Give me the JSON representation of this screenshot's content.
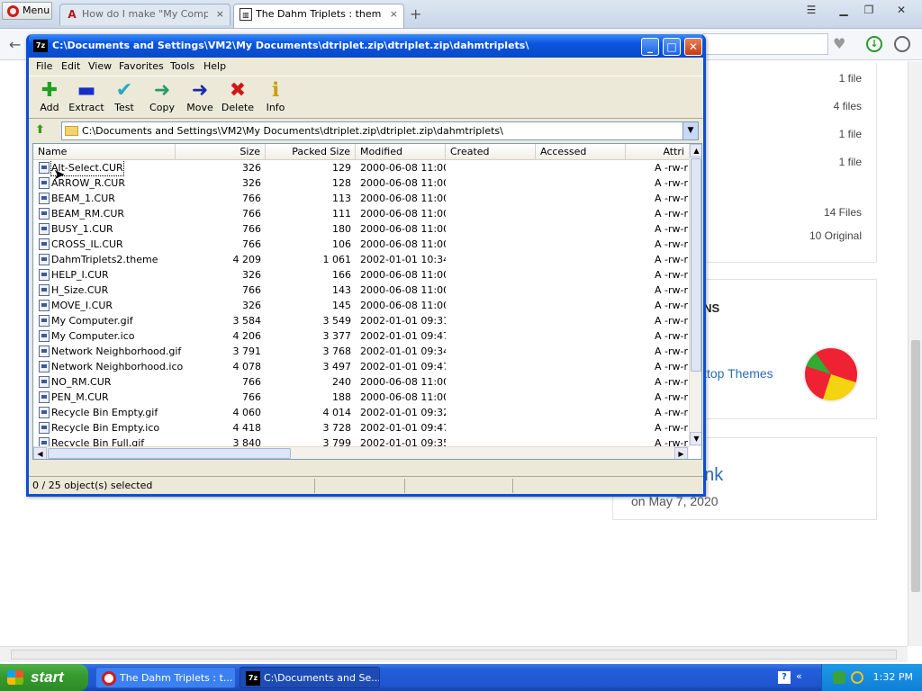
{
  "browser": {
    "menu_label": "Menu",
    "tabs": [
      {
        "title": "How do I make \"My Compute",
        "icon": "A",
        "active": false
      },
      {
        "title": "The Dahm Triplets : themewo",
        "icon": "▥",
        "active": true
      }
    ],
    "new_tab": "+",
    "close_glyph": "×"
  },
  "webpage": {
    "file_counts": [
      "1 file",
      "4 files",
      "1 file",
      "1 file"
    ],
    "total_files": "14 Files",
    "original": "10 Original",
    "section_heading": "ONS",
    "related_link": "sktop Themes",
    "post_title": "unk",
    "post_date": "on May 7, 2020"
  },
  "window": {
    "title": "C:\\Documents and Settings\\VM2\\My Documents\\dtriplet.zip\\dtriplet.zip\\dahmtriplets\\",
    "icon_label": "7z",
    "menu": [
      "File",
      "Edit",
      "View",
      "Favorites",
      "Tools",
      "Help"
    ],
    "toolbar": [
      {
        "label": "Add",
        "icon": "✚",
        "color": "#1ea11e"
      },
      {
        "label": "Extract",
        "icon": "▬",
        "color": "#1530c8"
      },
      {
        "label": "Test",
        "icon": "✔",
        "color": "#2aa7c7"
      },
      {
        "label": "Copy",
        "icon": "➜",
        "color": "#2a9a6a"
      },
      {
        "label": "Move",
        "icon": "➜",
        "color": "#1a2ab0"
      },
      {
        "label": "Delete",
        "icon": "✖",
        "color": "#d01818"
      },
      {
        "label": "Info",
        "icon": "ℹ",
        "color": "#c8a000"
      }
    ],
    "address": "C:\\Documents and Settings\\VM2\\My Documents\\dtriplet.zip\\dtriplet.zip\\dahmtriplets\\",
    "columns": [
      "Name",
      "Size",
      "Packed Size",
      "Modified",
      "Created",
      "Accessed",
      "Attri"
    ],
    "files": [
      {
        "name": "Alt-Select.CUR",
        "size": "326",
        "packed": "129",
        "modified": "2000-06-08 11:00",
        "attr": "A -rw-r"
      },
      {
        "name": "ARROW_R.CUR",
        "size": "326",
        "packed": "128",
        "modified": "2000-06-08 11:00",
        "attr": "A -rw-r"
      },
      {
        "name": "BEAM_1.CUR",
        "size": "766",
        "packed": "113",
        "modified": "2000-06-08 11:00",
        "attr": "A -rw-r"
      },
      {
        "name": "BEAM_RM.CUR",
        "size": "766",
        "packed": "111",
        "modified": "2000-06-08 11:00",
        "attr": "A -rw-r"
      },
      {
        "name": "BUSY_1.CUR",
        "size": "766",
        "packed": "180",
        "modified": "2000-06-08 11:00",
        "attr": "A -rw-r"
      },
      {
        "name": "CROSS_IL.CUR",
        "size": "766",
        "packed": "106",
        "modified": "2000-06-08 11:00",
        "attr": "A -rw-r"
      },
      {
        "name": "DahmTriplets2.theme",
        "size": "4 209",
        "packed": "1 061",
        "modified": "2002-01-01 10:34",
        "attr": "A -rw-r"
      },
      {
        "name": "HELP_I.CUR",
        "size": "326",
        "packed": "166",
        "modified": "2000-06-08 11:00",
        "attr": "A -rw-r"
      },
      {
        "name": "H_Size.CUR",
        "size": "766",
        "packed": "143",
        "modified": "2000-06-08 11:00",
        "attr": "A -rw-r"
      },
      {
        "name": "MOVE_I.CUR",
        "size": "326",
        "packed": "145",
        "modified": "2000-06-08 11:00",
        "attr": "A -rw-r"
      },
      {
        "name": "My Computer.gif",
        "size": "3 584",
        "packed": "3 549",
        "modified": "2002-01-01 09:31",
        "attr": "A -rw-r"
      },
      {
        "name": "My Computer.ico",
        "size": "4 206",
        "packed": "3 377",
        "modified": "2002-01-01 09:47",
        "attr": "A -rw-r"
      },
      {
        "name": "Network Neighborhood.gif",
        "size": "3 791",
        "packed": "3 768",
        "modified": "2002-01-01 09:34",
        "attr": "A -rw-r"
      },
      {
        "name": "Network Neighborhood.ico",
        "size": "4 078",
        "packed": "3 497",
        "modified": "2002-01-01 09:47",
        "attr": "A -rw-r"
      },
      {
        "name": "NO_RM.CUR",
        "size": "766",
        "packed": "240",
        "modified": "2000-06-08 11:00",
        "attr": "A -rw-r"
      },
      {
        "name": "PEN_M.CUR",
        "size": "766",
        "packed": "188",
        "modified": "2000-06-08 11:00",
        "attr": "A -rw-r"
      },
      {
        "name": "Recycle Bin Empty.gif",
        "size": "4 060",
        "packed": "4 014",
        "modified": "2002-01-01 09:32",
        "attr": "A -rw-r"
      },
      {
        "name": "Recycle Bin Empty.ico",
        "size": "4 418",
        "packed": "3 728",
        "modified": "2002-01-01 09:47",
        "attr": "A -rw-r"
      },
      {
        "name": "Recycle Bin Full.gif",
        "size": "3 840",
        "packed": "3 799",
        "modified": "2002-01-01 09:35",
        "attr": "A -rw-r"
      }
    ],
    "status": "0 / 25 object(s) selected"
  },
  "taskbar": {
    "start_label": "start",
    "tasks": [
      {
        "label": "The Dahm Triplets : t...",
        "icon": ""
      },
      {
        "label": "C:\\Documents and Se...",
        "icon": "7z"
      }
    ],
    "clock": "1:32 PM"
  }
}
